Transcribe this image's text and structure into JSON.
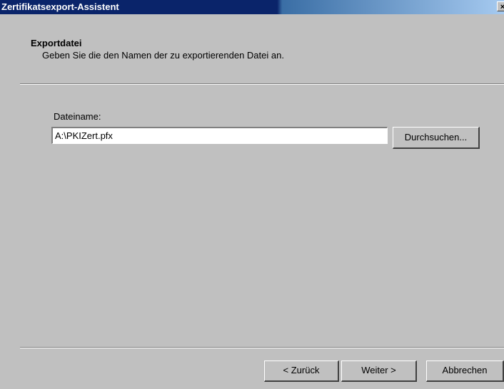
{
  "window": {
    "title": "Zertifikatsexport-Assistent",
    "close_glyph": "×"
  },
  "header": {
    "title": "Exportdatei",
    "subtitle": "Geben Sie die den Namen der zu exportierenden Datei an."
  },
  "form": {
    "filename_label": "Dateiname:",
    "filename_value": "A:\\PKIZert.pfx",
    "browse_label": "Durchsuchen..."
  },
  "footer": {
    "back_label": "< Zurück",
    "next_label": "Weiter >",
    "cancel_label": "Abbrechen"
  },
  "colors": {
    "dialog_bg": "#c0c0c0",
    "titlebar_active": "#0a246a",
    "titlebar_gradient_end": "#a6caf0"
  }
}
